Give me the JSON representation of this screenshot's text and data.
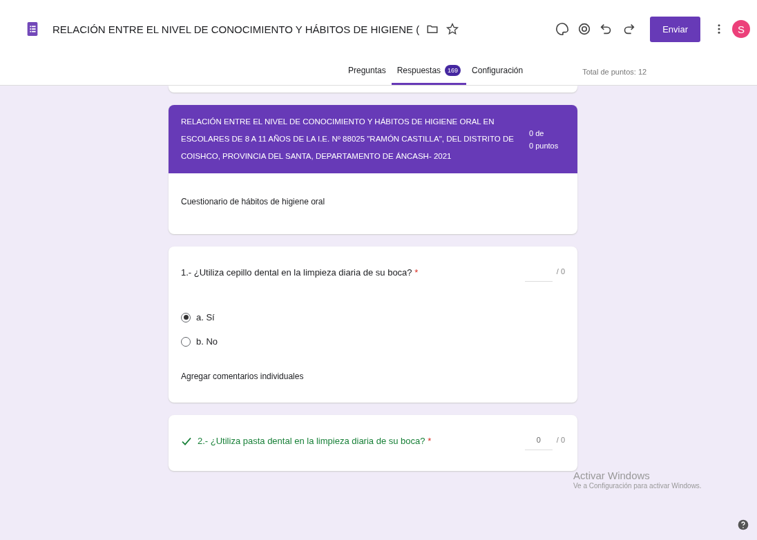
{
  "header": {
    "title": "RELACIÓN ENTRE EL NIVEL DE CONOCIMIENTO Y HÁBITOS DE HIGIENE (",
    "send_button": "Enviar",
    "avatar": "S"
  },
  "tabs": [
    {
      "label": "Preguntas",
      "selected": false
    },
    {
      "label": "Respuestas",
      "selected": true,
      "badge": "169"
    },
    {
      "label": "Configuración",
      "selected": false
    }
  ],
  "total_points": "Total de puntos: 12",
  "form_header": {
    "title": "RELACIÓN ENTRE EL NIVEL DE CONOCIMIENTO Y HÁBITOS DE HIGIENE ORAL EN ESCOLARES DE 8 A 11 AÑOS DE LA I.E. Nº 88025 \"RAMÓN CASTILLA\", DEL DISTRITO DE COISHCO, PROVINCIA DEL SANTA, DEPARTAMENTO DE ÁNCASH- 2021",
    "score_line_1": "0 de",
    "score_line_2": "0 puntos",
    "description": "Cuestionario de hábitos de higiene oral"
  },
  "questions": [
    {
      "text": "1.- ¿Utiliza cepillo dental en la limpieza diaria de su boca?",
      "required_mark": "*",
      "correct": false,
      "max": "/ 0",
      "options": [
        {
          "label": "a. Sí",
          "selected": true
        },
        {
          "label": "b. No",
          "selected": false
        }
      ],
      "comment_link": "Agregar comentarios individuales"
    },
    {
      "text": "2.- ¿Utiliza pasta dental en la limpieza diaria de su boca?",
      "required_mark": "*",
      "correct": true,
      "score": "0",
      "max": "/ 0"
    }
  ],
  "os_notice": {
    "title": "Activar Windows",
    "subtitle": "Ve a Configuración para activar Windows."
  }
}
